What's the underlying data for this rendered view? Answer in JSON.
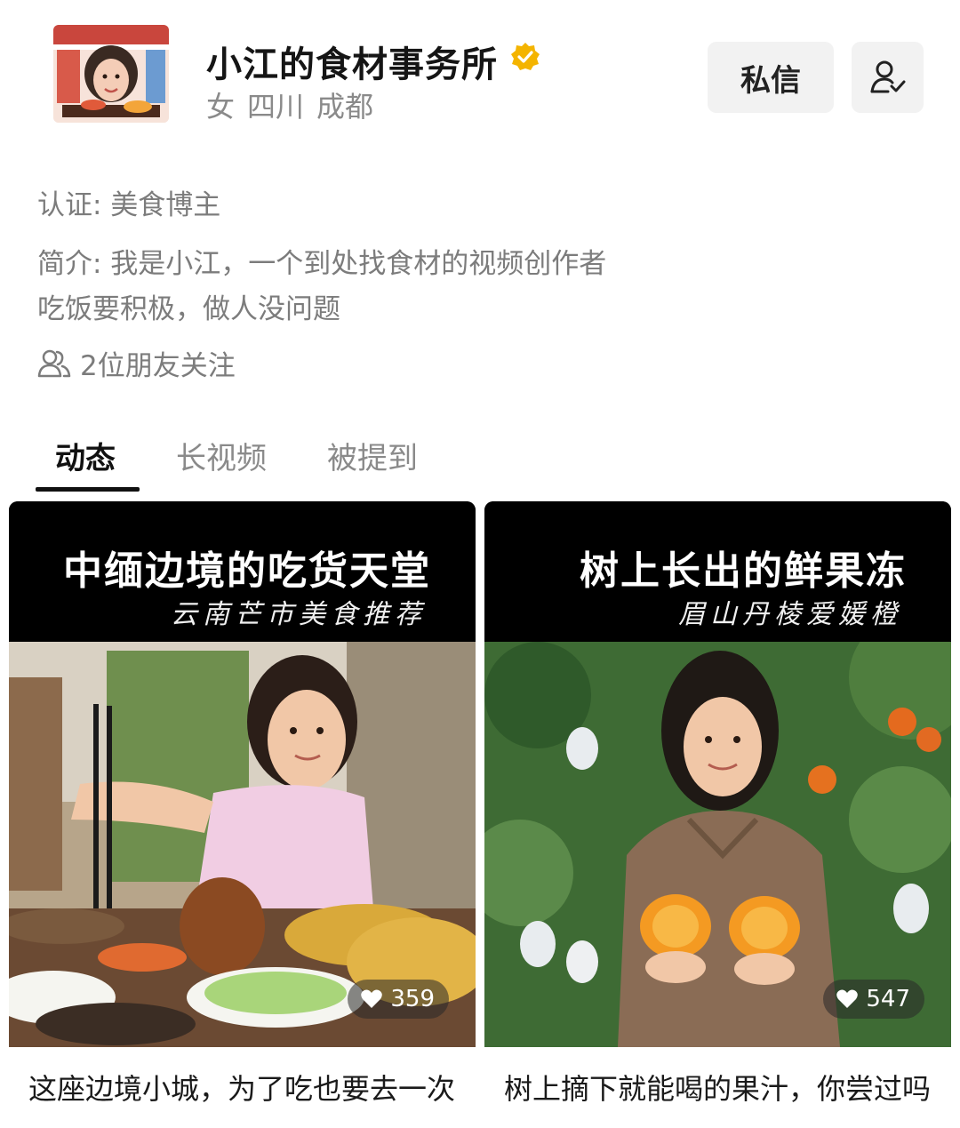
{
  "profile": {
    "name": "小江的食材事务所",
    "gender": "女",
    "province": "四川",
    "city": "成都",
    "verified_color": "#F4B400"
  },
  "actions": {
    "message_label": "私信",
    "follow_icon": "user-check-icon"
  },
  "bio": {
    "certification": "认证: 美食博主",
    "intro_line1": "简介: 我是小江，一个到处找食材的视频创作者",
    "intro_line2": "吃饭要积极，做人没问题",
    "friends_following": "2位朋友关注"
  },
  "tabs": [
    {
      "label": "动态",
      "active": true
    },
    {
      "label": "长视频",
      "active": false
    },
    {
      "label": "被提到",
      "active": false
    }
  ],
  "posts": [
    {
      "cover_title": "中缅边境的吃货天堂",
      "cover_subtitle": "云南芒市美食推荐",
      "likes": "359",
      "caption": "这座边境小城，为了吃也要去一次"
    },
    {
      "cover_title": "树上长出的鲜果冻",
      "cover_subtitle": "眉山丹棱爱媛橙",
      "likes": "547",
      "caption": "树上摘下就能喝的果汁，你尝过吗"
    }
  ]
}
